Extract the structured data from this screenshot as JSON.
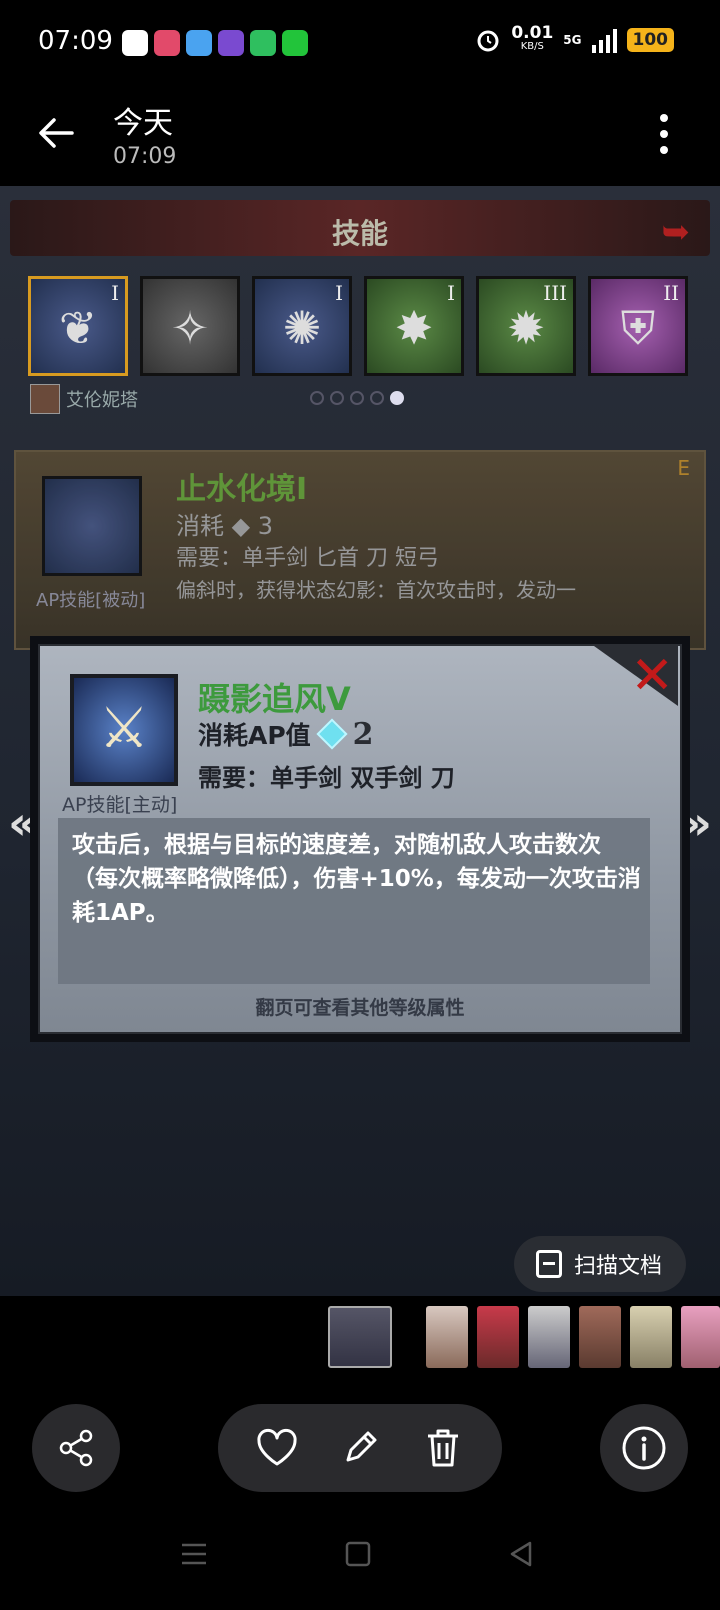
{
  "status_bar": {
    "time": "07:09",
    "net_speed": "0.01",
    "net_unit": "KB/S",
    "network": "5G",
    "battery": "100",
    "icons": [
      "baidu-icon",
      "taobao-icon",
      "weather-icon",
      "app-icon",
      "battery-saver-icon",
      "green-app-icon",
      "alarm-icon",
      "signal-icon"
    ]
  },
  "header": {
    "title": "今天",
    "subtitle": "07:09"
  },
  "game": {
    "header_title": "技能",
    "skills": [
      {
        "rank": "I",
        "color": "blue",
        "glyph": "❦"
      },
      {
        "rank": "",
        "color": "gray",
        "glyph": "✧"
      },
      {
        "rank": "I",
        "color": "blue",
        "glyph": "✺"
      },
      {
        "rank": "I",
        "color": "green",
        "glyph": "✸"
      },
      {
        "rank": "III",
        "color": "green",
        "glyph": "✹"
      },
      {
        "rank": "II",
        "color": "purple",
        "glyph": "⛨"
      }
    ],
    "character_name": "艾伦妮塔",
    "bg_card": {
      "name": "止水化境I",
      "cost_label": "消耗",
      "cost_value": "3",
      "need": "需要：单手剑 匕首 刀 短弓",
      "desc": "偏斜时，获得状态幻影：首次攻击时，发动一",
      "type": "AP技能[被动]",
      "corner": "E"
    },
    "popup": {
      "name": "蹑影追风V",
      "cost_label": "消耗AP值",
      "cost_value": "2",
      "need": "需要：单手剑 双手剑 刀",
      "type": "AP技能[主动]",
      "description": "攻击后，根据与目标的速度差，对随机敌人攻击数次（每次概率略微降低），伤害+10%，每发动一次攻击消耗1AP。",
      "hint": "翻页可查看其他等级属性"
    }
  },
  "scan_button": {
    "label": "扫描文档"
  },
  "colors": {
    "accent_battery": "#f5b31a",
    "skill_green": "#3d9a3d",
    "close_red": "#c21a1a"
  }
}
